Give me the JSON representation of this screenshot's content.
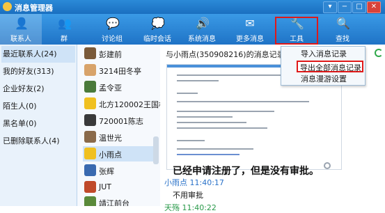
{
  "window": {
    "title": "消息管理器",
    "controls": [
      "▾",
      "−",
      "□",
      "✕"
    ]
  },
  "toolbar": {
    "items": [
      {
        "label": "联系人",
        "icon": "person-icon",
        "glyph": "👤"
      },
      {
        "label": "群",
        "icon": "group-icon",
        "glyph": "👥"
      },
      {
        "label": "讨论组",
        "icon": "discussion-icon",
        "glyph": "💬"
      },
      {
        "label": "临时会话",
        "icon": "temp-chat-icon",
        "glyph": "💭"
      },
      {
        "label": "系统消息",
        "icon": "speaker-icon",
        "glyph": "🔊"
      },
      {
        "label": "更多消息",
        "icon": "more-messages-icon",
        "glyph": "✉"
      },
      {
        "label": "工具",
        "icon": "wrench-icon",
        "glyph": "🔧"
      },
      {
        "label": "查找",
        "icon": "search-icon",
        "glyph": "🔍"
      }
    ]
  },
  "categories": [
    "最近联系人(24)",
    "我的好友(313)",
    "企业好友(2)",
    "陌生人(0)",
    "黑名单(0)",
    "已删除联系人(4)"
  ],
  "contacts": [
    {
      "name": "彭建前",
      "color": "#7a5a3a"
    },
    {
      "name": "3214田冬亭",
      "color": "#d8a36a"
    },
    {
      "name": "孟令亚",
      "color": "#4a7a3a"
    },
    {
      "name": "北方120002王国栋",
      "color": "#f0c020"
    },
    {
      "name": "720001陈志",
      "color": "#3a3a3a"
    },
    {
      "name": "温世光",
      "color": "#8a6a4a"
    },
    {
      "name": "小雨点",
      "color": "#f0c020"
    },
    {
      "name": "张辉",
      "color": "#3a6ab0"
    },
    {
      "name": "JUT",
      "color": "#c04a2a"
    },
    {
      "name": "靖江前台",
      "color": "#5a8a3a"
    }
  ],
  "history": {
    "title": "与小雨点(350908216)的消息记录",
    "message_big": "已经申请注册了，但是没有审批。",
    "sender1": "小雨点  11:40:17",
    "message_small": "不用审批",
    "sender2": "天殇  11:40:22"
  },
  "tools_menu": {
    "items": [
      "导入消息记录",
      "导出全部消息记录",
      "消息漫游设置"
    ]
  },
  "colors": {
    "accent": "#1f73c6",
    "highlight": "#e01818"
  }
}
